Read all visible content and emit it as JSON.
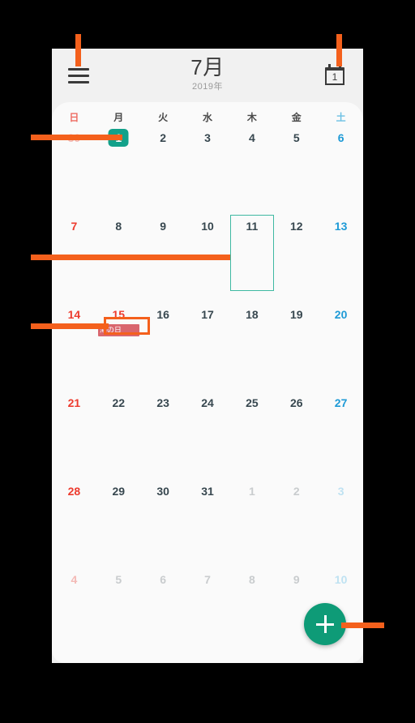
{
  "app": {
    "header": {
      "menu_icon": "hamburger-menu-icon",
      "month": "7月",
      "year": "2019年",
      "today_icon": "calendar-today-icon",
      "today_icon_number": "1"
    },
    "weekdays": [
      {
        "label": "日",
        "kind": "sun"
      },
      {
        "label": "月",
        "kind": "wd"
      },
      {
        "label": "火",
        "kind": "wd"
      },
      {
        "label": "水",
        "kind": "wd"
      },
      {
        "label": "木",
        "kind": "wd"
      },
      {
        "label": "金",
        "kind": "wd"
      },
      {
        "label": "土",
        "kind": "sat"
      }
    ],
    "weeks": [
      [
        {
          "n": "30",
          "kind": "out sun"
        },
        {
          "n": "1",
          "kind": "wd",
          "today": true
        },
        {
          "n": "2",
          "kind": "wd"
        },
        {
          "n": "3",
          "kind": "wd"
        },
        {
          "n": "4",
          "kind": "wd"
        },
        {
          "n": "5",
          "kind": "wd"
        },
        {
          "n": "6",
          "kind": "sat"
        }
      ],
      [
        {
          "n": "7",
          "kind": "sun"
        },
        {
          "n": "8",
          "kind": "wd"
        },
        {
          "n": "9",
          "kind": "wd"
        },
        {
          "n": "10",
          "kind": "wd"
        },
        {
          "n": "11",
          "kind": "wd",
          "selected": true
        },
        {
          "n": "12",
          "kind": "wd"
        },
        {
          "n": "13",
          "kind": "sat"
        }
      ],
      [
        {
          "n": "14",
          "kind": "sun"
        },
        {
          "n": "15",
          "kind": "hol",
          "event": "海の日"
        },
        {
          "n": "16",
          "kind": "wd"
        },
        {
          "n": "17",
          "kind": "wd"
        },
        {
          "n": "18",
          "kind": "wd"
        },
        {
          "n": "19",
          "kind": "wd"
        },
        {
          "n": "20",
          "kind": "sat"
        }
      ],
      [
        {
          "n": "21",
          "kind": "sun"
        },
        {
          "n": "22",
          "kind": "wd"
        },
        {
          "n": "23",
          "kind": "wd"
        },
        {
          "n": "24",
          "kind": "wd"
        },
        {
          "n": "25",
          "kind": "wd"
        },
        {
          "n": "26",
          "kind": "wd"
        },
        {
          "n": "27",
          "kind": "sat"
        }
      ],
      [
        {
          "n": "28",
          "kind": "sun"
        },
        {
          "n": "29",
          "kind": "wd"
        },
        {
          "n": "30",
          "kind": "wd"
        },
        {
          "n": "31",
          "kind": "wd"
        },
        {
          "n": "1",
          "kind": "out"
        },
        {
          "n": "2",
          "kind": "out"
        },
        {
          "n": "3",
          "kind": "out sat"
        }
      ],
      [
        {
          "n": "4",
          "kind": "out sun"
        },
        {
          "n": "5",
          "kind": "out"
        },
        {
          "n": "6",
          "kind": "out"
        },
        {
          "n": "7",
          "kind": "out"
        },
        {
          "n": "8",
          "kind": "out"
        },
        {
          "n": "9",
          "kind": "out"
        },
        {
          "n": "10",
          "kind": "out sat"
        }
      ]
    ],
    "fab": {
      "icon": "plus-icon",
      "label": ""
    }
  },
  "annotations": {
    "color": "#F4601C",
    "targets": [
      "hamburger-menu-icon",
      "calendar-today-icon",
      "today-badge-july-1",
      "selected-day-july-11",
      "event-chip-marine-day",
      "add-event-fab"
    ]
  },
  "colors": {
    "accent_teal": "#0E9B77",
    "today_badge": "#12A18A",
    "selection_outline": "#3FB9A2",
    "sunday_red": "#ED3B2E",
    "saturday_blue": "#1E9AD6",
    "event_chip": "#D9666E",
    "annotation_orange": "#F4601C",
    "header_bg": "#F1F1F1",
    "card_bg": "#FAFAFA"
  }
}
